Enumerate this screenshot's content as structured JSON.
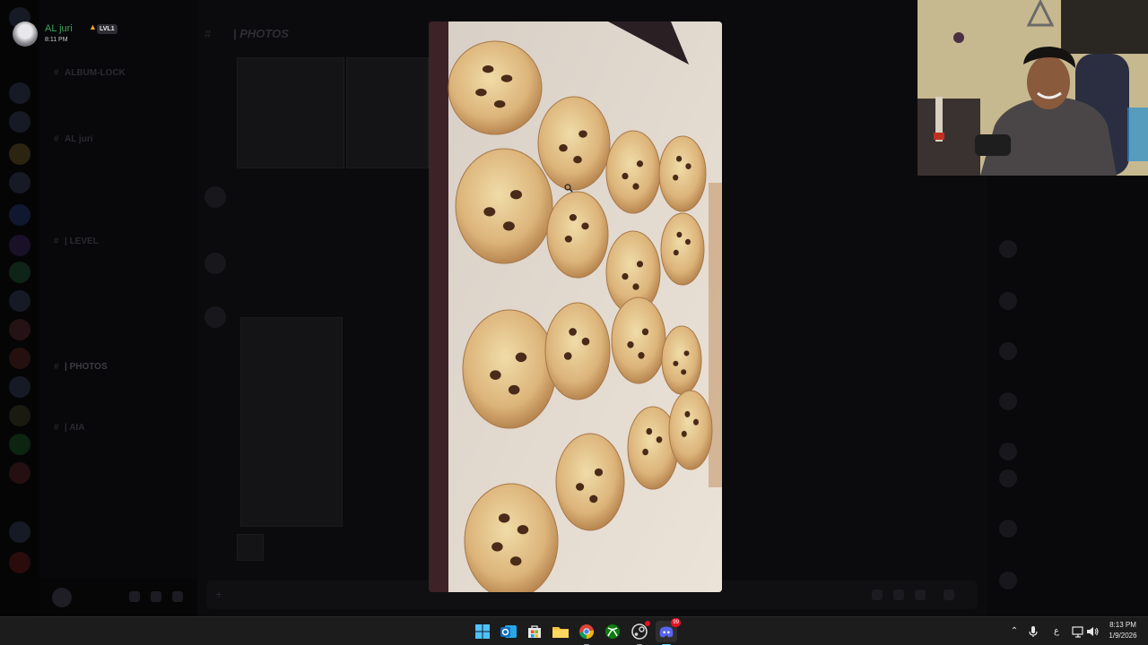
{
  "uploader": {
    "name": "AL juri",
    "level_badge": "LVL1",
    "time": "8:11 PM"
  },
  "viewer": {
    "image_subject": "cookies-on-baking-tray"
  },
  "background_dimmed": {
    "channel_title": "| PHOTOS",
    "channels": [
      "ALBUM-LOCK",
      "AL juri",
      "| LEVEL",
      "| PHOTOS",
      "| AIA"
    ],
    "selected_channel": "| PHOTOS"
  },
  "taskbar": {
    "apps": [
      {
        "name": "start",
        "icon": "windows-logo-icon"
      },
      {
        "name": "outlook",
        "icon": "outlook-icon"
      },
      {
        "name": "store",
        "icon": "store-icon"
      },
      {
        "name": "file-explorer",
        "icon": "folder-icon"
      },
      {
        "name": "chrome",
        "icon": "chrome-icon"
      },
      {
        "name": "xbox",
        "icon": "xbox-icon"
      },
      {
        "name": "steam",
        "icon": "steam-icon"
      },
      {
        "name": "discord",
        "icon": "discord-icon"
      }
    ],
    "discord_badge": "99",
    "language": "ع",
    "time": "8:13 PM",
    "date": "1/9/2026"
  },
  "colors": {
    "taskbar_bg": "#1c1c1c",
    "username_green": "#3ba55c",
    "discord_blurple": "#5865f2",
    "notification_red": "#e81123"
  }
}
